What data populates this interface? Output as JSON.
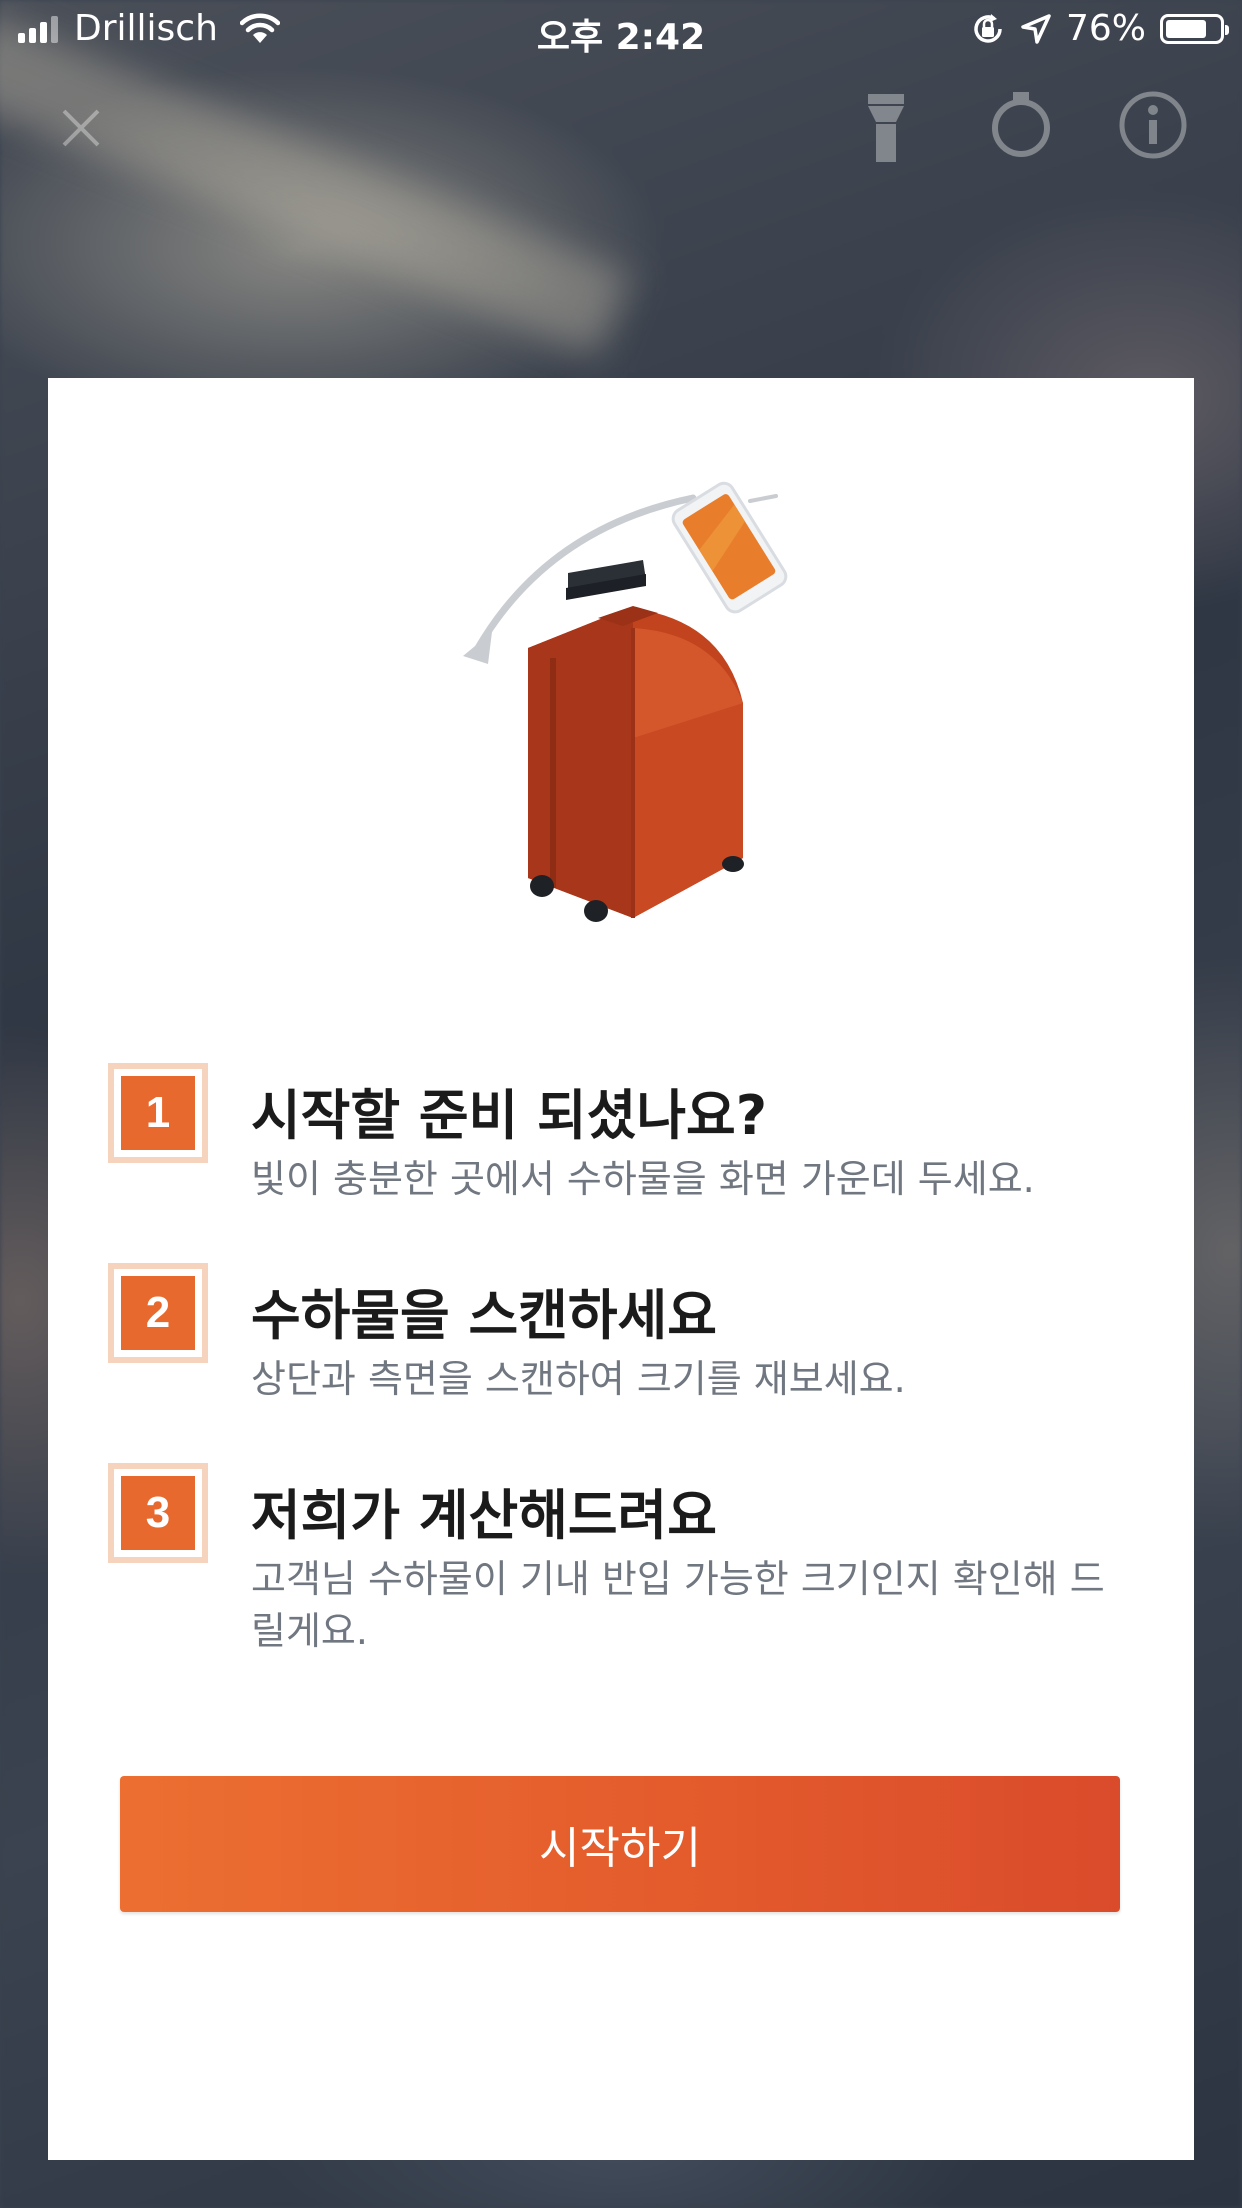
{
  "status_bar": {
    "carrier": "Drillisch",
    "time": "오후 2:42",
    "battery_percent": "76%",
    "battery_level": 0.76
  },
  "camera_toolbar": {
    "icons": [
      "close-icon",
      "flashlight-icon",
      "timer-icon",
      "info-icon"
    ]
  },
  "onboarding": {
    "steps": [
      {
        "number": "1",
        "title": "시작할 준비 되셨나요?",
        "description": "빛이 충분한 곳에서 수하물을 화면 가운데 두세요."
      },
      {
        "number": "2",
        "title": "수하물을 스캔하세요",
        "description": "상단과 측면을 스캔하여 크기를 재보세요."
      },
      {
        "number": "3",
        "title": "저희가 계산해드려요",
        "description": "고객님 수하물이 기내 반입 가능한 크기인지 확인해 드릴게요."
      }
    ],
    "start_button_label": "시작하기"
  },
  "colors": {
    "accent": "#e8692e",
    "badge_border": "#f5d3bd",
    "title_text": "#1b1b1b",
    "description_text": "#707780",
    "suitcase": "#c94a22"
  }
}
